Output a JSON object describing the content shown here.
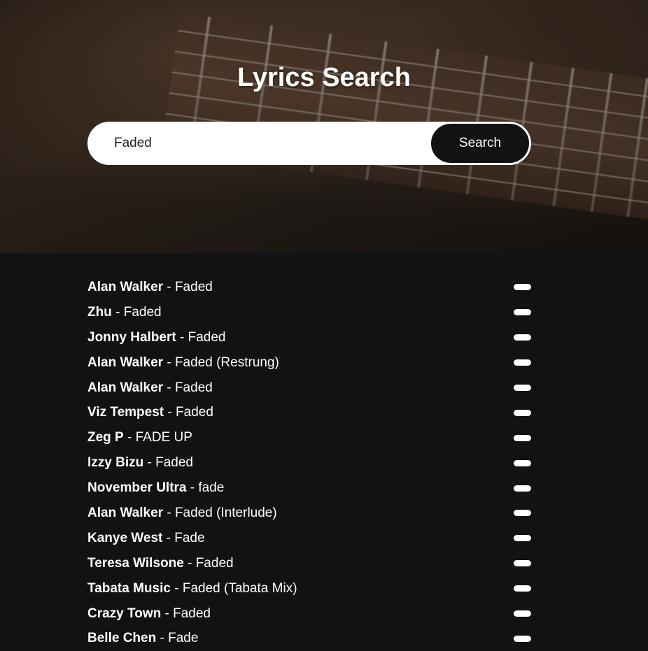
{
  "header": {
    "title": "Lyrics Search"
  },
  "search": {
    "value": "Faded",
    "button_label": "Search"
  },
  "results": [
    {
      "artist": "Alan Walker",
      "separator": " - ",
      "title": "Faded"
    },
    {
      "artist": "Zhu",
      "separator": " - ",
      "title": "Faded"
    },
    {
      "artist": "Jonny Halbert",
      "separator": " - ",
      "title": "Faded"
    },
    {
      "artist": "Alan Walker",
      "separator": " - ",
      "title": "Faded (Restrung)"
    },
    {
      "artist": "Alan Walker",
      "separator": " - ",
      "title": "Faded"
    },
    {
      "artist": "Viz Tempest",
      "separator": " - ",
      "title": "Faded"
    },
    {
      "artist": "Zeg P",
      "separator": " - ",
      "title": "FADE UP"
    },
    {
      "artist": "Izzy Bizu",
      "separator": " - ",
      "title": "Faded"
    },
    {
      "artist": "November Ultra",
      "separator": " - ",
      "title": "fade"
    },
    {
      "artist": "Alan Walker",
      "separator": " - ",
      "title": "Faded (Interlude)"
    },
    {
      "artist": "Kanye West",
      "separator": " - ",
      "title": "Fade"
    },
    {
      "artist": "Teresa Wilsone",
      "separator": " - ",
      "title": "Faded"
    },
    {
      "artist": "Tabata Music",
      "separator": " - ",
      "title": "Faded (Tabata Mix)"
    },
    {
      "artist": "Crazy Town",
      "separator": " - ",
      "title": "Faded"
    },
    {
      "artist": "Belle Chen",
      "separator": " - ",
      "title": "Fade"
    }
  ],
  "colors": {
    "background": "#121212",
    "text": "#ffffff",
    "button": "#121212"
  }
}
